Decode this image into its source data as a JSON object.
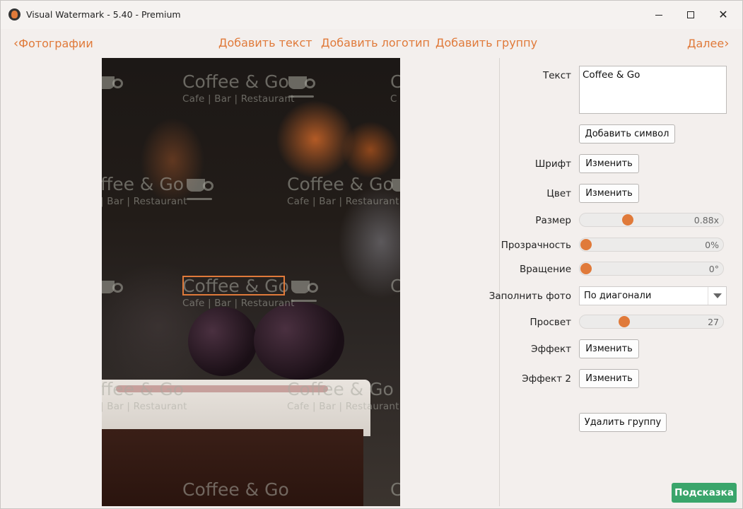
{
  "window": {
    "title": "Visual Watermark - 5.40 - Premium",
    "controls": {
      "minimize": "minimize-icon",
      "maximize": "maximize-icon",
      "close": "close-icon"
    }
  },
  "toolbar": {
    "back_chevron": "‹",
    "back_label": "Фотографии",
    "add_text": "Добавить текст",
    "add_logo": "Добавить логотип",
    "add_group": "Добавить группу",
    "next_label": "Далее",
    "next_chevron": "›"
  },
  "photo": {
    "watermark": {
      "title": "Coffee & Go",
      "title_partial_left": "ffee & Go",
      "title_partial_right": "C",
      "subtitle": "Cafe | Bar | Restaurant",
      "subtitle_partial_left": "| Bar | Restaurant",
      "subtitle_partial_right": "C",
      "icon": "coffee-cup-icon"
    }
  },
  "panel": {
    "text_label": "Текст",
    "text_value": "Coffee & Go",
    "add_symbol": "Добавить символ",
    "font_label": "Шрифт",
    "font_button": "Изменить",
    "color_label": "Цвет",
    "color_button": "Изменить",
    "size_label": "Размер",
    "size_value": "0.88x",
    "size_fraction": 0.32,
    "opacity_label": "Прозрачность",
    "opacity_value": "0%",
    "opacity_fraction": 0,
    "rotation_label": "Вращение",
    "rotation_value": "0°",
    "rotation_fraction": 0,
    "fill_label": "Заполнить фото",
    "fill_value": "По диагонали",
    "gap_label": "Просвет",
    "gap_value": "27",
    "gap_fraction": 0.29,
    "effect_label": "Эффект",
    "effect_button": "Изменить",
    "effect2_label": "Эффект 2",
    "effect2_button": "Изменить",
    "delete_group": "Удалить группу"
  },
  "help_button": "Подсказка",
  "colors": {
    "accent": "#e07a3a",
    "help": "#3aa56b"
  }
}
